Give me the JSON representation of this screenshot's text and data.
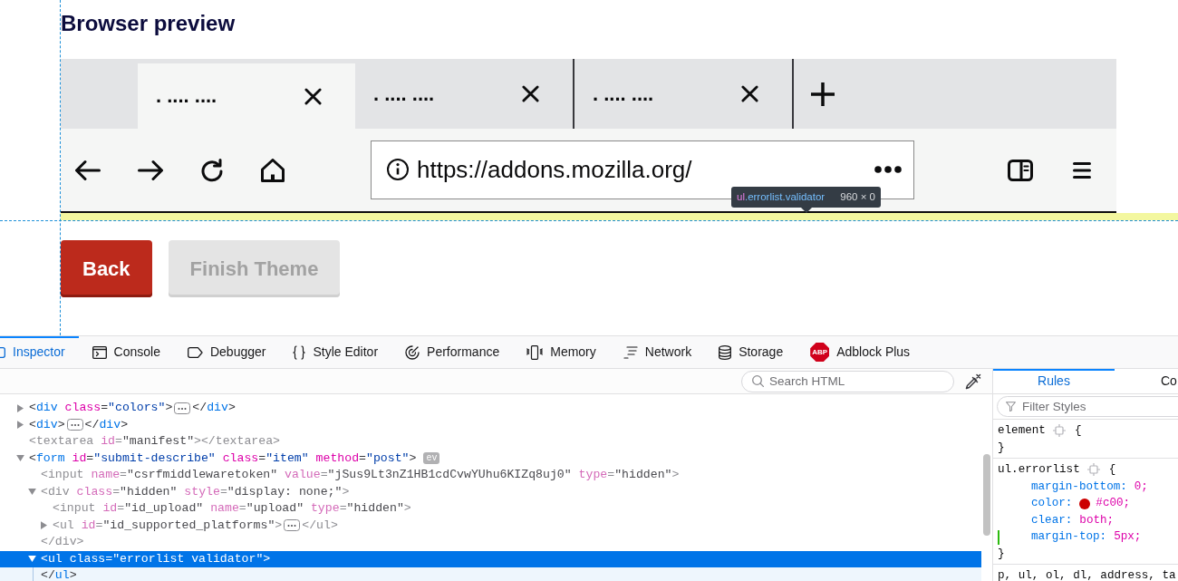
{
  "page": {
    "title": "Browser preview"
  },
  "preview": {
    "tabs": [
      {
        "label": ". .... ....",
        "selected": true
      },
      {
        "label": ". .... ....",
        "selected": false
      },
      {
        "label": ". .... ....",
        "selected": false
      }
    ],
    "url": "https://addons.mozilla.org/"
  },
  "tooltip": {
    "tag": "ul",
    "classes": ".errorlist.validator",
    "size": "960 × 0"
  },
  "buttons": [
    {
      "label": "Back",
      "disabled": false
    },
    {
      "label": "Finish Theme",
      "disabled": true
    }
  ],
  "devtools": {
    "tabs": [
      {
        "label": "Inspector",
        "kind": "tool",
        "selected": true
      },
      {
        "label": "Console",
        "kind": "tool",
        "selected": false
      },
      {
        "label": "Debugger",
        "kind": "tool",
        "selected": false
      },
      {
        "label": "Style Editor",
        "kind": "tool",
        "selected": false
      },
      {
        "label": "Performance",
        "kind": "tool",
        "selected": false
      },
      {
        "label": "Memory",
        "kind": "tool",
        "selected": false
      },
      {
        "label": "Network",
        "kind": "tool",
        "selected": false
      },
      {
        "label": "Storage",
        "kind": "tool",
        "selected": false
      },
      {
        "label": "Adblock Plus",
        "kind": "addon",
        "logo_text": "ABP",
        "selected": false
      }
    ],
    "search_placeholder": "Search HTML",
    "markup": [
      {
        "expanded": false,
        "dimmed": false,
        "selected": false,
        "parts": [
          {
            "kind": "punct",
            "text": "<"
          },
          {
            "kind": "tag",
            "text": "div"
          },
          {
            "kind": "attr",
            "text": " class"
          },
          {
            "kind": "punct",
            "text": "="
          },
          {
            "kind": "value",
            "text": "\"colors\""
          },
          {
            "kind": "punct",
            "text": ">"
          },
          {
            "kind": "ellipsis"
          },
          {
            "kind": "punct",
            "text": "</"
          },
          {
            "kind": "tag",
            "text": "div"
          },
          {
            "kind": "punct",
            "text": ">"
          }
        ]
      },
      {
        "expanded": false,
        "dimmed": false,
        "selected": false,
        "parts": [
          {
            "kind": "punct",
            "text": "<"
          },
          {
            "kind": "tag",
            "text": "div"
          },
          {
            "kind": "punct",
            "text": ">"
          },
          {
            "kind": "ellipsis"
          },
          {
            "kind": "punct",
            "text": "</"
          },
          {
            "kind": "tag",
            "text": "div"
          },
          {
            "kind": "punct",
            "text": ">"
          }
        ]
      },
      {
        "dimmed": true,
        "selected": false,
        "parts": [
          {
            "kind": "punct",
            "text": "<"
          },
          {
            "kind": "tag",
            "text": "textarea"
          },
          {
            "kind": "attr",
            "text": " id"
          },
          {
            "kind": "punct",
            "text": "="
          },
          {
            "kind": "value",
            "text": "\"manifest\""
          },
          {
            "kind": "punct",
            "text": "></"
          },
          {
            "kind": "tag",
            "text": "textarea"
          },
          {
            "kind": "punct",
            "text": ">"
          }
        ]
      },
      {
        "expanded": true,
        "dimmed": false,
        "selected": false,
        "parts": [
          {
            "kind": "punct",
            "text": "<"
          },
          {
            "kind": "tag",
            "text": "form"
          },
          {
            "kind": "attr",
            "text": " id"
          },
          {
            "kind": "punct",
            "text": "="
          },
          {
            "kind": "value",
            "text": "\"submit-describe\""
          },
          {
            "kind": "attr",
            "text": " class"
          },
          {
            "kind": "punct",
            "text": "="
          },
          {
            "kind": "value",
            "text": "\"item\""
          },
          {
            "kind": "attr",
            "text": " method"
          },
          {
            "kind": "punct",
            "text": "="
          },
          {
            "kind": "value",
            "text": "\"post\""
          },
          {
            "kind": "punct",
            "text": ">"
          },
          {
            "kind": "badge",
            "text": "ev"
          }
        ],
        "children": [
          {
            "dimmed": true,
            "selected": false,
            "parts": [
              {
                "kind": "punct",
                "text": "<"
              },
              {
                "kind": "tag",
                "text": "input"
              },
              {
                "kind": "attr",
                "text": " name"
              },
              {
                "kind": "punct",
                "text": "="
              },
              {
                "kind": "value",
                "text": "\"csrfmiddlewaretoken\""
              },
              {
                "kind": "attr",
                "text": " value"
              },
              {
                "kind": "punct",
                "text": "="
              },
              {
                "kind": "value",
                "text": "\"jSus9Lt3nZ1HB1cdCvwYUhu6KIZq8uj0\""
              },
              {
                "kind": "attr",
                "text": " type"
              },
              {
                "kind": "punct",
                "text": "="
              },
              {
                "kind": "value",
                "text": "\"hidden\""
              },
              {
                "kind": "punct",
                "text": ">"
              }
            ]
          },
          {
            "expanded": true,
            "dimmed": true,
            "selected": false,
            "parts": [
              {
                "kind": "punct",
                "text": "<"
              },
              {
                "kind": "tag",
                "text": "div"
              },
              {
                "kind": "attr",
                "text": " class"
              },
              {
                "kind": "punct",
                "text": "="
              },
              {
                "kind": "value",
                "text": "\"hidden\""
              },
              {
                "kind": "attr",
                "text": " style"
              },
              {
                "kind": "punct",
                "text": "="
              },
              {
                "kind": "value",
                "text": "\"display: none;\""
              },
              {
                "kind": "punct",
                "text": ">"
              }
            ],
            "children": [
              {
                "dimmed": true,
                "selected": false,
                "parts": [
                  {
                    "kind": "punct",
                    "text": "<"
                  },
                  {
                    "kind": "tag",
                    "text": "input"
                  },
                  {
                    "kind": "attr",
                    "text": " id"
                  },
                  {
                    "kind": "punct",
                    "text": "="
                  },
                  {
                    "kind": "value",
                    "text": "\"id_upload\""
                  },
                  {
                    "kind": "attr",
                    "text": " name"
                  },
                  {
                    "kind": "punct",
                    "text": "="
                  },
                  {
                    "kind": "value",
                    "text": "\"upload\""
                  },
                  {
                    "kind": "attr",
                    "text": " type"
                  },
                  {
                    "kind": "punct",
                    "text": "="
                  },
                  {
                    "kind": "value",
                    "text": "\"hidden\""
                  },
                  {
                    "kind": "punct",
                    "text": ">"
                  }
                ]
              },
              {
                "expanded": false,
                "dimmed": true,
                "selected": false,
                "parts": [
                  {
                    "kind": "punct",
                    "text": "<"
                  },
                  {
                    "kind": "tag",
                    "text": "ul"
                  },
                  {
                    "kind": "attr",
                    "text": " id"
                  },
                  {
                    "kind": "punct",
                    "text": "="
                  },
                  {
                    "kind": "value",
                    "text": "\"id_supported_platforms\""
                  },
                  {
                    "kind": "punct",
                    "text": ">"
                  },
                  {
                    "kind": "ellipsis"
                  },
                  {
                    "kind": "punct",
                    "text": "</"
                  },
                  {
                    "kind": "tag",
                    "text": "ul"
                  },
                  {
                    "kind": "punct",
                    "text": ">"
                  }
                ]
              }
            ],
            "closing": [
              {
                "kind": "punct",
                "text": "</"
              },
              {
                "kind": "tag",
                "text": "div"
              },
              {
                "kind": "punct",
                "text": ">"
              }
            ]
          },
          {
            "expanded": true,
            "dimmed": false,
            "selected": true,
            "parts": [
              {
                "kind": "punct",
                "text": "<"
              },
              {
                "kind": "tag",
                "text": "ul"
              },
              {
                "kind": "attr",
                "text": " class"
              },
              {
                "kind": "punct",
                "text": "="
              },
              {
                "kind": "value",
                "text": "\"errorlist validator\""
              },
              {
                "kind": "punct",
                "text": ">"
              }
            ],
            "closing": [
              {
                "kind": "punct",
                "text": "</"
              },
              {
                "kind": "tag",
                "text": "ul"
              },
              {
                "kind": "punct",
                "text": ">"
              }
            ]
          }
        ]
      }
    ],
    "sidebar": {
      "tabs": [
        {
          "label": "Rules",
          "selected": true
        },
        {
          "label": "Co",
          "selected": false
        }
      ],
      "filter_placeholder": "Filter Styles",
      "rules": [
        {
          "selector": "element",
          "open": "{",
          "close": "}"
        },
        {
          "selector": "ul.errorlist",
          "open": "{",
          "declarations": [
            {
              "property": "margin-bottom:",
              "value": "0;",
              "changed": false
            },
            {
              "property": "color:",
              "value": "#c00;",
              "color": "#cc0000",
              "changed": false
            },
            {
              "property": "clear:",
              "value": "both;",
              "changed": false
            },
            {
              "property": "margin-top:",
              "value": "5px;",
              "changed": true
            }
          ],
          "close": "}"
        },
        {
          "selector": "p, ul, ol, dl, address, ta"
        }
      ]
    }
  }
}
